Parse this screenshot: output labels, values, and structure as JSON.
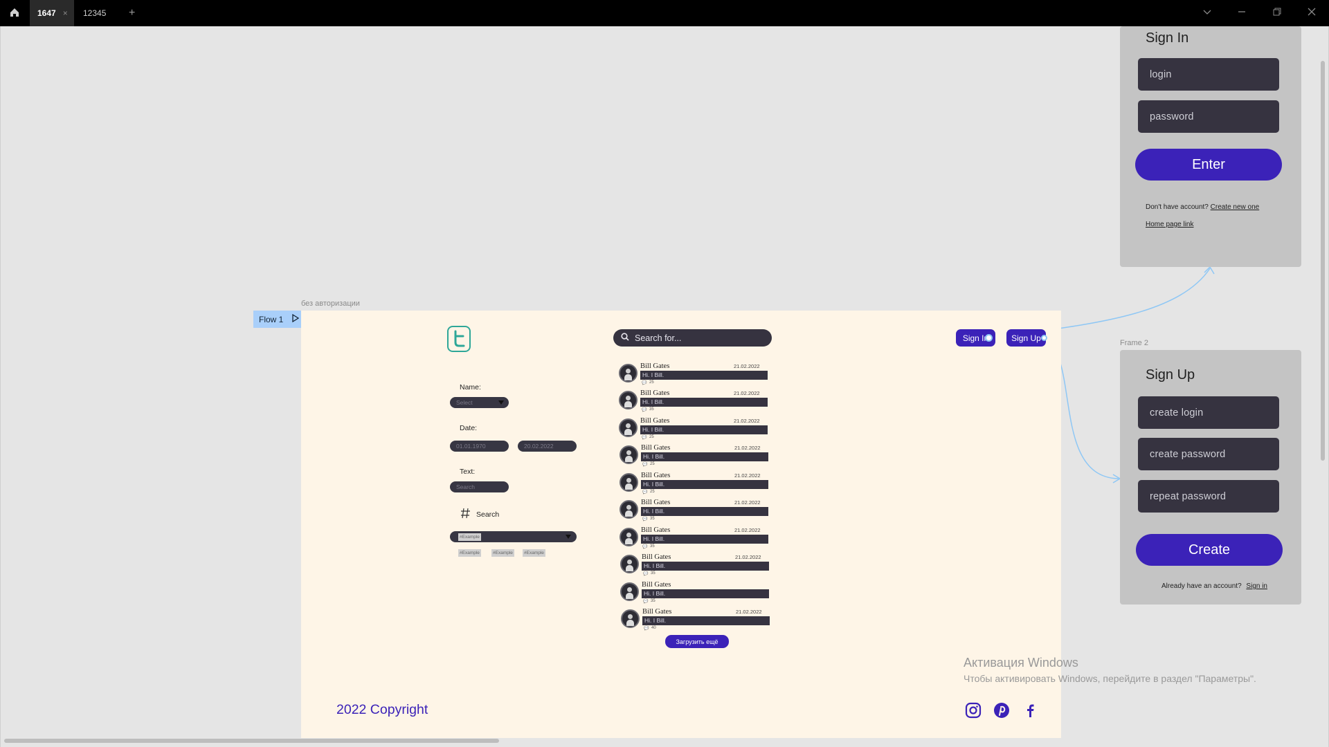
{
  "window": {
    "tabs": [
      {
        "label": "1647",
        "active": true
      },
      {
        "label": "12345",
        "active": false
      }
    ],
    "new_tab_label": "+"
  },
  "canvas": {
    "flow_label": "Flow 1",
    "main_frame_label": "без авторизации",
    "frame2_label": "Frame 2"
  },
  "main": {
    "search_placeholder": "Search for...",
    "sign_in": "Sign In",
    "sign_up": "Sign Up",
    "filters": {
      "name_label": "Name:",
      "name_select": "Select",
      "date_label": "Date:",
      "date_from": "01.01.1970",
      "date_to": "20.02.2022",
      "text_label": "Text:",
      "text_placeholder": "Search",
      "hashtag_search_label": "Search",
      "tag_select": "#Example",
      "tags": [
        "#Example",
        "#Example",
        "#Example"
      ]
    },
    "posts": [
      {
        "author": "Bill Gates",
        "date": "21.02.2022",
        "text": "Hi. I Bill.",
        "comments": "25"
      },
      {
        "author": "Bill Gates",
        "date": "21.02.2022",
        "text": "Hi. I Bill.",
        "comments": "35"
      },
      {
        "author": "Bill Gates",
        "date": "21.02.2022",
        "text": "Hi. I Bill.",
        "comments": "25"
      },
      {
        "author": "Bill Gates",
        "date": "21.02.2022",
        "text": "Hi. I Bill.",
        "comments": "25"
      },
      {
        "author": "Bill Gates",
        "date": "21.02.2022",
        "text": "Hi. I Bill.",
        "comments": "25"
      },
      {
        "author": "Bill Gates",
        "date": "21.02.2022",
        "text": "Hi. I Bill.",
        "comments": "35"
      },
      {
        "author": "Bill Gates",
        "date": "21.02.2022",
        "text": "Hi. I Bill.",
        "comments": "35"
      },
      {
        "author": "Bill Gates",
        "date": "21.02.2022",
        "text": "Hi. I Bill.",
        "comments": "35"
      },
      {
        "author": "Bill Gates",
        "date": "",
        "text": "Hi. I Bill.",
        "comments": "35"
      },
      {
        "author": "Bill Gates",
        "date": "21.02.2022",
        "text": "Hi. I Bill.",
        "comments": "40"
      }
    ],
    "load_more": "Загрузить ещё",
    "copyright": "2022 Copyright"
  },
  "signin": {
    "title": "Sign In",
    "login_placeholder": "login",
    "password_placeholder": "password",
    "enter": "Enter",
    "no_account_text": "Don't have account?",
    "create_link": "Create new one",
    "home_link": "Home page link"
  },
  "signup": {
    "title": "Sign Up",
    "login_placeholder": "create login",
    "password_placeholder": "create password",
    "repeat_placeholder": "repeat password",
    "create": "Create",
    "have_account_text": "Already have an account?",
    "signin_link": "Sign in"
  },
  "watermark": {
    "line1": "Активация Windows",
    "line2": "Чтобы активировать Windows, перейдите в раздел \"Параметры\"."
  },
  "colors": {
    "accent": "#3b22b8",
    "frame_bg": "#fef5e7",
    "panel_bg": "#c4c4c4",
    "input_bg": "#363340",
    "logo": "#2ea798",
    "flow_line": "#8ec7f5"
  },
  "icons": [
    "home-icon",
    "close-icon",
    "plus-icon",
    "chevron-down-icon",
    "minimize-icon",
    "restore-icon",
    "search-icon",
    "twitter-logo-icon",
    "hashtag-icon",
    "comment-icon",
    "instagram-icon",
    "pinterest-icon",
    "facebook-icon",
    "play-icon"
  ]
}
